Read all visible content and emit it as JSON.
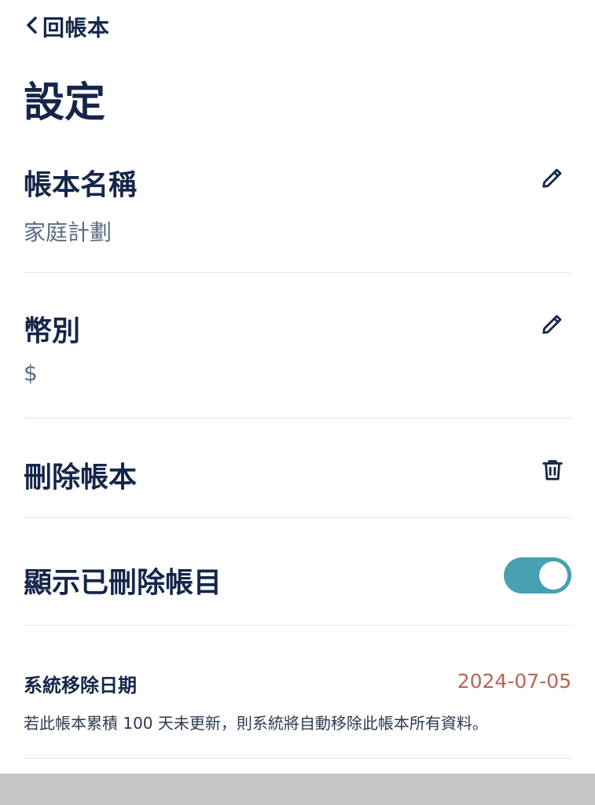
{
  "nav": {
    "back_label": "回帳本",
    "back_icon": "chevron-left-icon"
  },
  "page": {
    "title": "設定"
  },
  "ledger_name": {
    "label": "帳本名稱",
    "value": "家庭計劃",
    "edit_icon": "pencil-icon"
  },
  "currency": {
    "label": "幣別",
    "value": "$",
    "edit_icon": "pencil-icon"
  },
  "delete_ledger": {
    "label": "刪除帳本",
    "icon": "trash-icon"
  },
  "show_deleted": {
    "label": "顯示已刪除帳目",
    "toggle_on": true
  },
  "system_removal": {
    "label": "系統移除日期",
    "date": "2024-07-05",
    "note": "若此帳本累積 100 天未更新，則系統將自動移除此帳本所有資料。"
  },
  "colors": {
    "primary_text": "#15264a",
    "secondary_text": "#5d6c84",
    "toggle_on": "#47a1b1",
    "date_text": "#b86556",
    "bottom_bar": "#c7c7c7"
  }
}
